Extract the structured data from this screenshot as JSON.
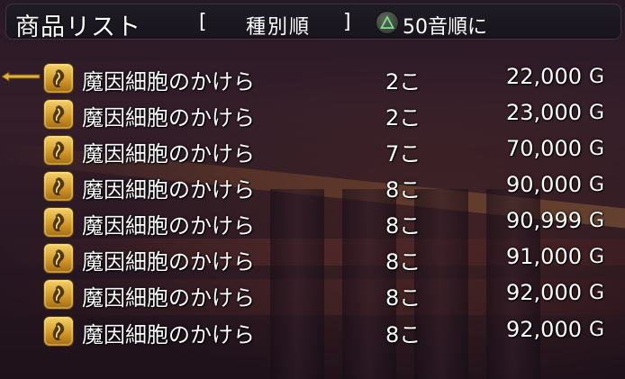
{
  "header": {
    "title": "商品リスト",
    "bracket_open": "[",
    "sort_mode": "種別順",
    "bracket_close": "]",
    "triangle_button_icon": "triangle-button-icon",
    "alt_sort_label": "50音順に"
  },
  "list": {
    "selected_index": 0,
    "items": [
      {
        "name": "魔因細胞のかけら",
        "qty": "2こ",
        "price": "22,000",
        "currency": "G",
        "icon": "item-fragment-icon"
      },
      {
        "name": "魔因細胞のかけら",
        "qty": "2こ",
        "price": "23,000",
        "currency": "G",
        "icon": "item-fragment-icon"
      },
      {
        "name": "魔因細胞のかけら",
        "qty": "7こ",
        "price": "70,000",
        "currency": "G",
        "icon": "item-fragment-icon"
      },
      {
        "name": "魔因細胞のかけら",
        "qty": "8こ",
        "price": "90,000",
        "currency": "G",
        "icon": "item-fragment-icon"
      },
      {
        "name": "魔因細胞のかけら",
        "qty": "8こ",
        "price": "90,999",
        "currency": "G",
        "icon": "item-fragment-icon"
      },
      {
        "name": "魔因細胞のかけら",
        "qty": "8こ",
        "price": "91,000",
        "currency": "G",
        "icon": "item-fragment-icon"
      },
      {
        "name": "魔因細胞のかけら",
        "qty": "8こ",
        "price": "92,000",
        "currency": "G",
        "icon": "item-fragment-icon"
      },
      {
        "name": "魔因細胞のかけら",
        "qty": "8こ",
        "price": "92,000",
        "currency": "G",
        "icon": "item-fragment-icon"
      }
    ]
  },
  "colors": {
    "text": "#ffffff",
    "icon_gold": "#d39a2a",
    "cursor_gold": "#e0b040"
  }
}
